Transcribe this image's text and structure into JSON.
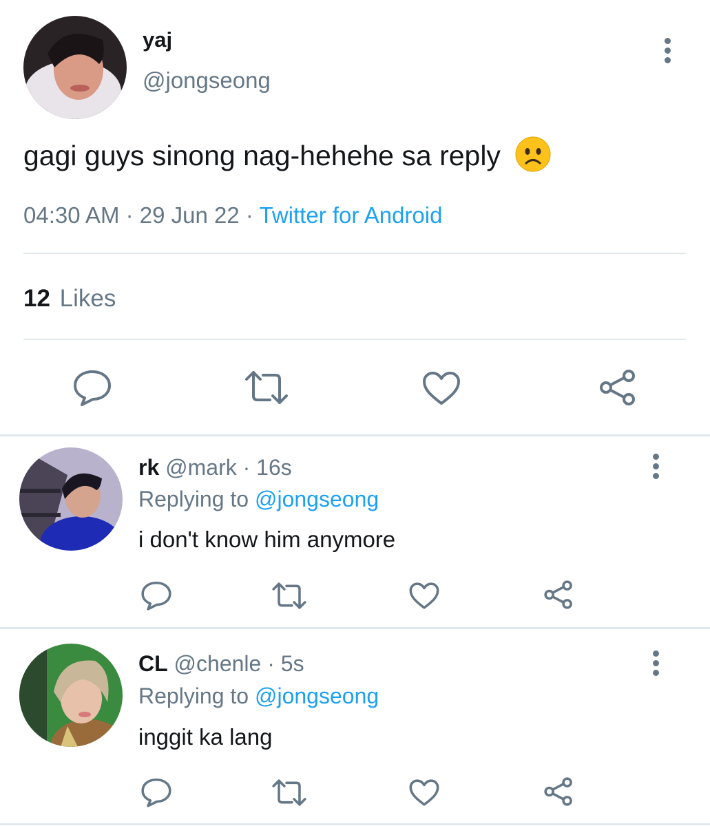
{
  "tweet": {
    "display_name": "yaj",
    "handle": "@jongseong",
    "text": "gagi guys sinong nag-hehehe sa reply",
    "emoji": "worried-face",
    "time": "04:30 AM",
    "date": "29 Jun 22",
    "dot": "·",
    "source": "Twitter for Android",
    "likes_count": "12",
    "likes_label": "Likes"
  },
  "replies": [
    {
      "display_name": "rk",
      "handle": "@mark",
      "age": "16s",
      "replying_label": "Replying to",
      "replying_handle": "@jongseong",
      "text": "i don't know him anymore"
    },
    {
      "display_name": "CL",
      "handle": "@chenle",
      "age": "5s",
      "replying_label": "Replying to",
      "replying_handle": "@jongseong",
      "text": "inggit ka lang"
    }
  ],
  "icons": {
    "reply": "reply-icon",
    "retweet": "retweet-icon",
    "like": "like-icon",
    "share": "share-icon",
    "more": "more-options-icon"
  },
  "colors": {
    "link": "#1da1f2",
    "muted": "#657786",
    "divider": "#e1e8ed"
  }
}
